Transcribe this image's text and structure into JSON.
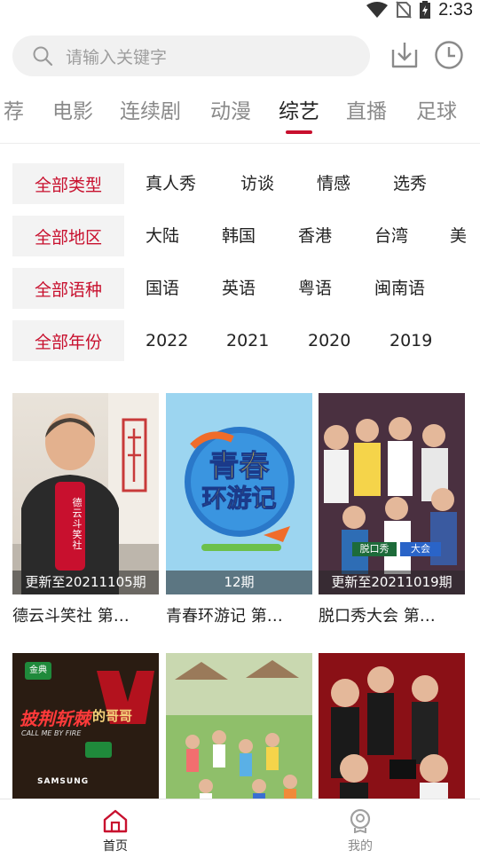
{
  "status_bar": {
    "time": "2:33"
  },
  "search": {
    "placeholder": "请输入关键字"
  },
  "tabs": [
    {
      "label": "荐"
    },
    {
      "label": "电影"
    },
    {
      "label": "连续剧"
    },
    {
      "label": "动漫"
    },
    {
      "label": "综艺",
      "active": true
    },
    {
      "label": "直播"
    },
    {
      "label": "足球"
    }
  ],
  "filters": [
    {
      "label": "全部类型",
      "options": [
        "真人秀",
        "访谈",
        "情感",
        "选秀"
      ]
    },
    {
      "label": "全部地区",
      "options": [
        "大陆",
        "韩国",
        "香港",
        "台湾",
        "美"
      ]
    },
    {
      "label": "全部语种",
      "options": [
        "国语",
        "英语",
        "粤语",
        "闽南语"
      ]
    },
    {
      "label": "全部年份",
      "options": [
        "2022",
        "2021",
        "2020",
        "2019"
      ]
    }
  ],
  "cards": [
    {
      "title": "德云斗笑社 第…",
      "badge": "更新至20211105期"
    },
    {
      "title": "青春环游记 第…",
      "badge": "12期"
    },
    {
      "title": "脱口秀大会 第…",
      "badge": "更新至20211019期"
    },
    {
      "title": "",
      "badge": ""
    },
    {
      "title": "",
      "badge": ""
    },
    {
      "title": "",
      "badge": ""
    }
  ],
  "posters": {
    "card0": {
      "text1": "德",
      "text2": "云",
      "text3": "斗",
      "text4": "笑",
      "text5": "社"
    },
    "card1": {
      "line1": "青春",
      "line2": "环游记"
    },
    "card2": {
      "text": "脱口秀",
      "text2": "大会"
    },
    "card3": {
      "line1": "披荆斩棘",
      "line2": "的哥哥",
      "line3": "CALL ME BY FIRE",
      "brand": "SAMSUNG",
      "logo": "金典"
    }
  },
  "bottom_nav": [
    {
      "label": "首页",
      "active": true
    },
    {
      "label": "我的",
      "active": false
    }
  ],
  "colors": {
    "accent": "#c8102e",
    "inactive": "#8a8a8a"
  }
}
